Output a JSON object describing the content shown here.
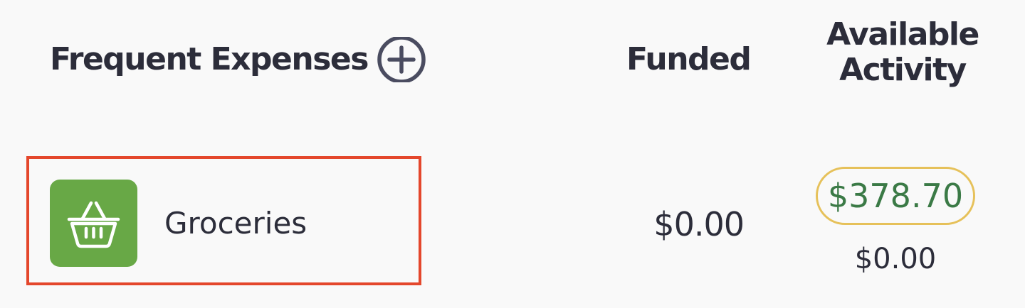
{
  "header": {
    "title": "Frequent Expenses",
    "add_icon": "plus-circle-icon",
    "funded_label": "Funded",
    "available_label": "Available",
    "activity_label": "Activity"
  },
  "category": {
    "name": "Groceries",
    "icon": "shopping-basket-icon",
    "icon_color": "#68a846",
    "funded": "$0.00",
    "available": "$378.70",
    "activity": "$0.00"
  },
  "colors": {
    "highlight_border": "#e4472c",
    "available_positive": "#3b7a46",
    "pill_border": "#e6c15a"
  }
}
